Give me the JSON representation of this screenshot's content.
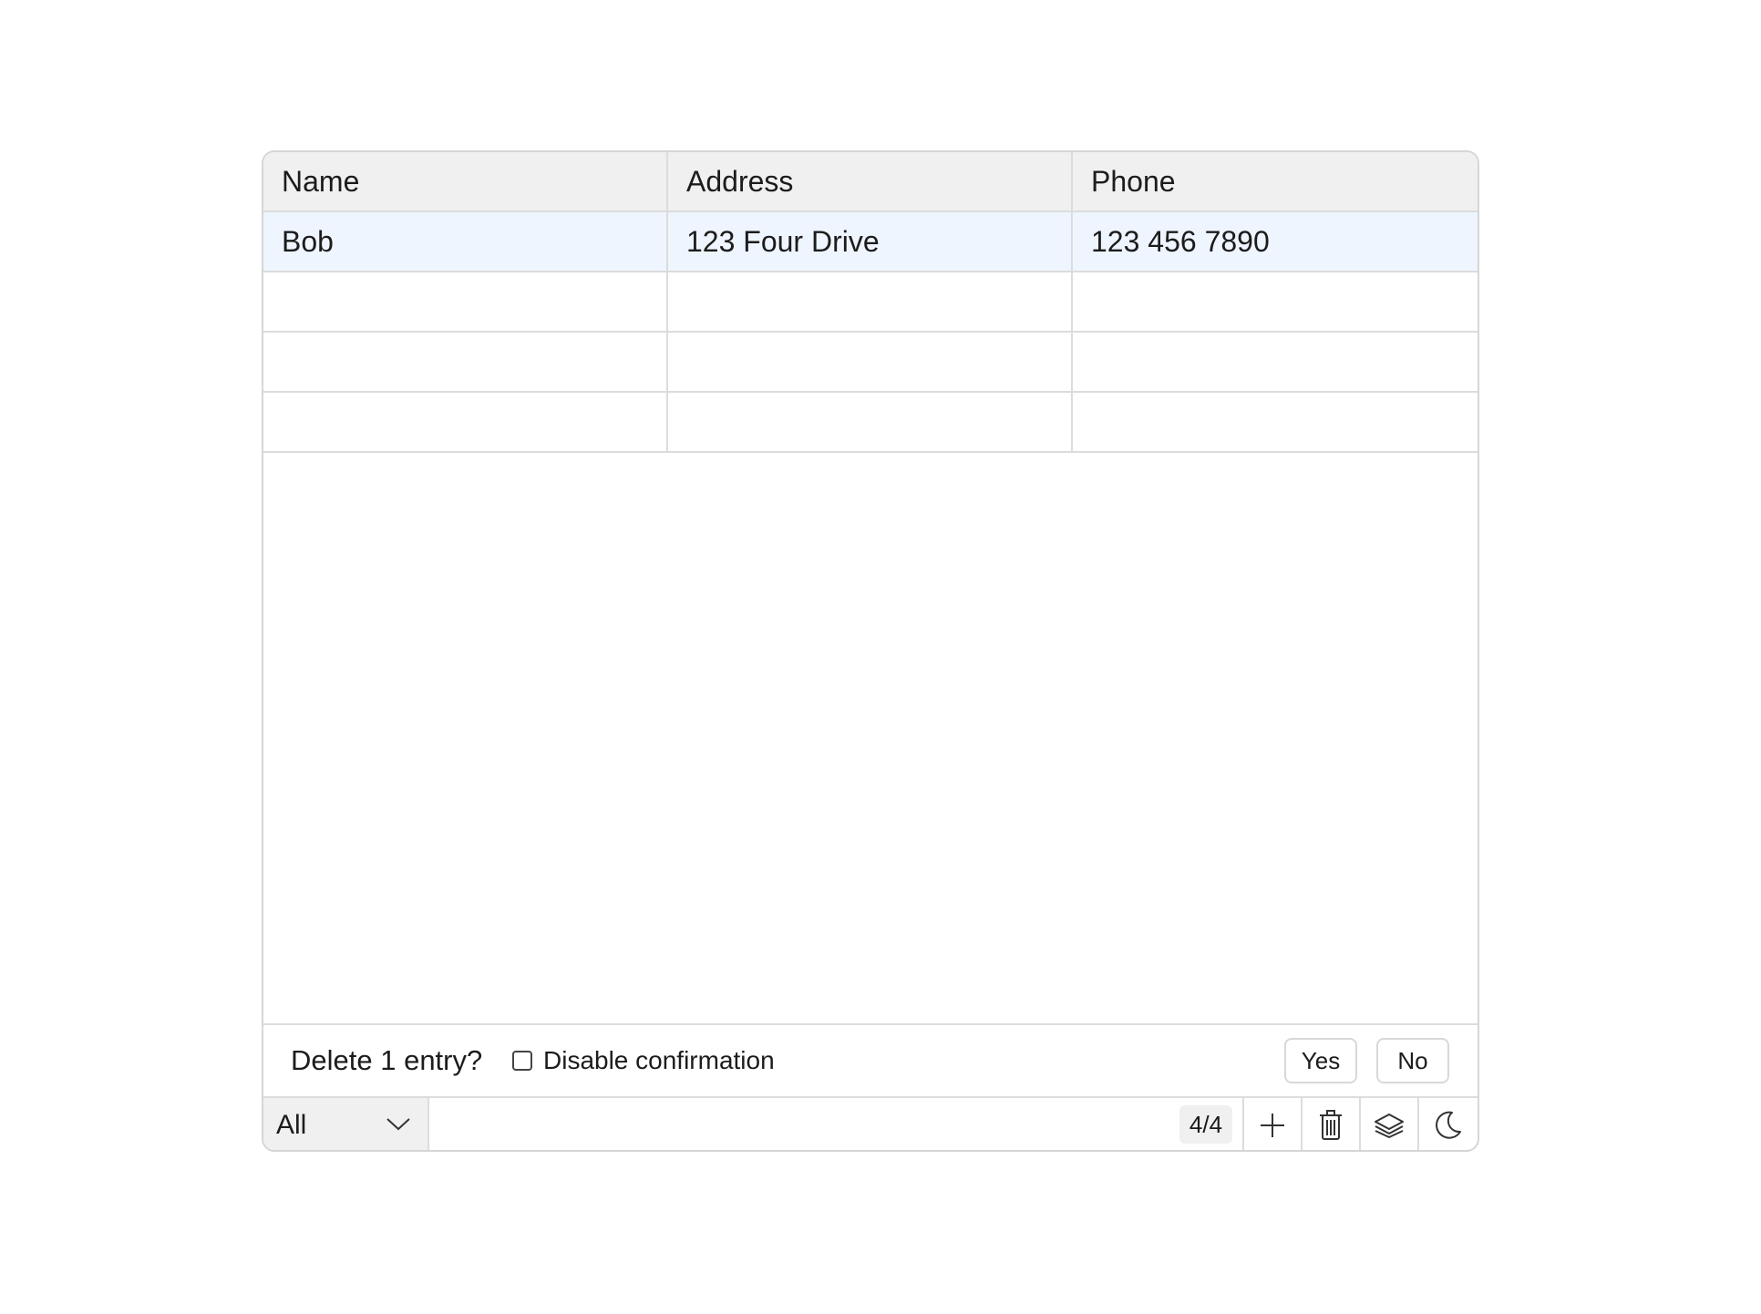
{
  "table": {
    "columns": [
      "Name",
      "Address",
      "Phone"
    ],
    "rows": [
      [
        "Bob",
        "123 Four Drive",
        "123 456 7890"
      ],
      [
        "",
        "",
        ""
      ],
      [
        "",
        "",
        ""
      ],
      [
        "",
        "",
        ""
      ]
    ],
    "selected_row": 0
  },
  "confirm": {
    "message": "Delete 1 entry?",
    "checkbox_label": "Disable confirmation",
    "checkbox_checked": false,
    "yes_label": "Yes",
    "no_label": "No"
  },
  "toolbar": {
    "filter_value": "All",
    "count": "4/4",
    "icons": [
      "plus-icon",
      "trash-icon",
      "layers-icon",
      "moon-icon",
      "chevron-down-icon"
    ]
  },
  "colors": {
    "header_bg": "#f0f0f0",
    "selected_row_bg": "#eff5fe",
    "border": "#dcdcdc"
  }
}
